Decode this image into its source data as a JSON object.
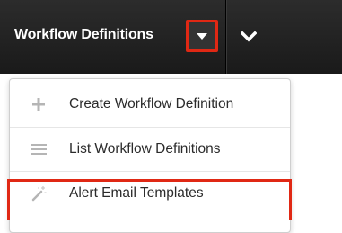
{
  "navbar": {
    "tab_title": "Workflow Definitions",
    "dropdown_icon": "caret-down-icon",
    "more_icon": "chevron-down-icon"
  },
  "menu": {
    "items": [
      {
        "label": "Create Workflow Definition",
        "icon": "plus-icon"
      },
      {
        "label": "List Workflow Definitions",
        "icon": "list-icon"
      },
      {
        "label": "Alert Email Templates",
        "icon": "magic-wand-icon"
      }
    ]
  },
  "colors": {
    "highlight": "#e02814",
    "navbar_bg": "#222222",
    "menu_text": "#2b2b2b",
    "icon_gray": "#b5b5b5"
  }
}
